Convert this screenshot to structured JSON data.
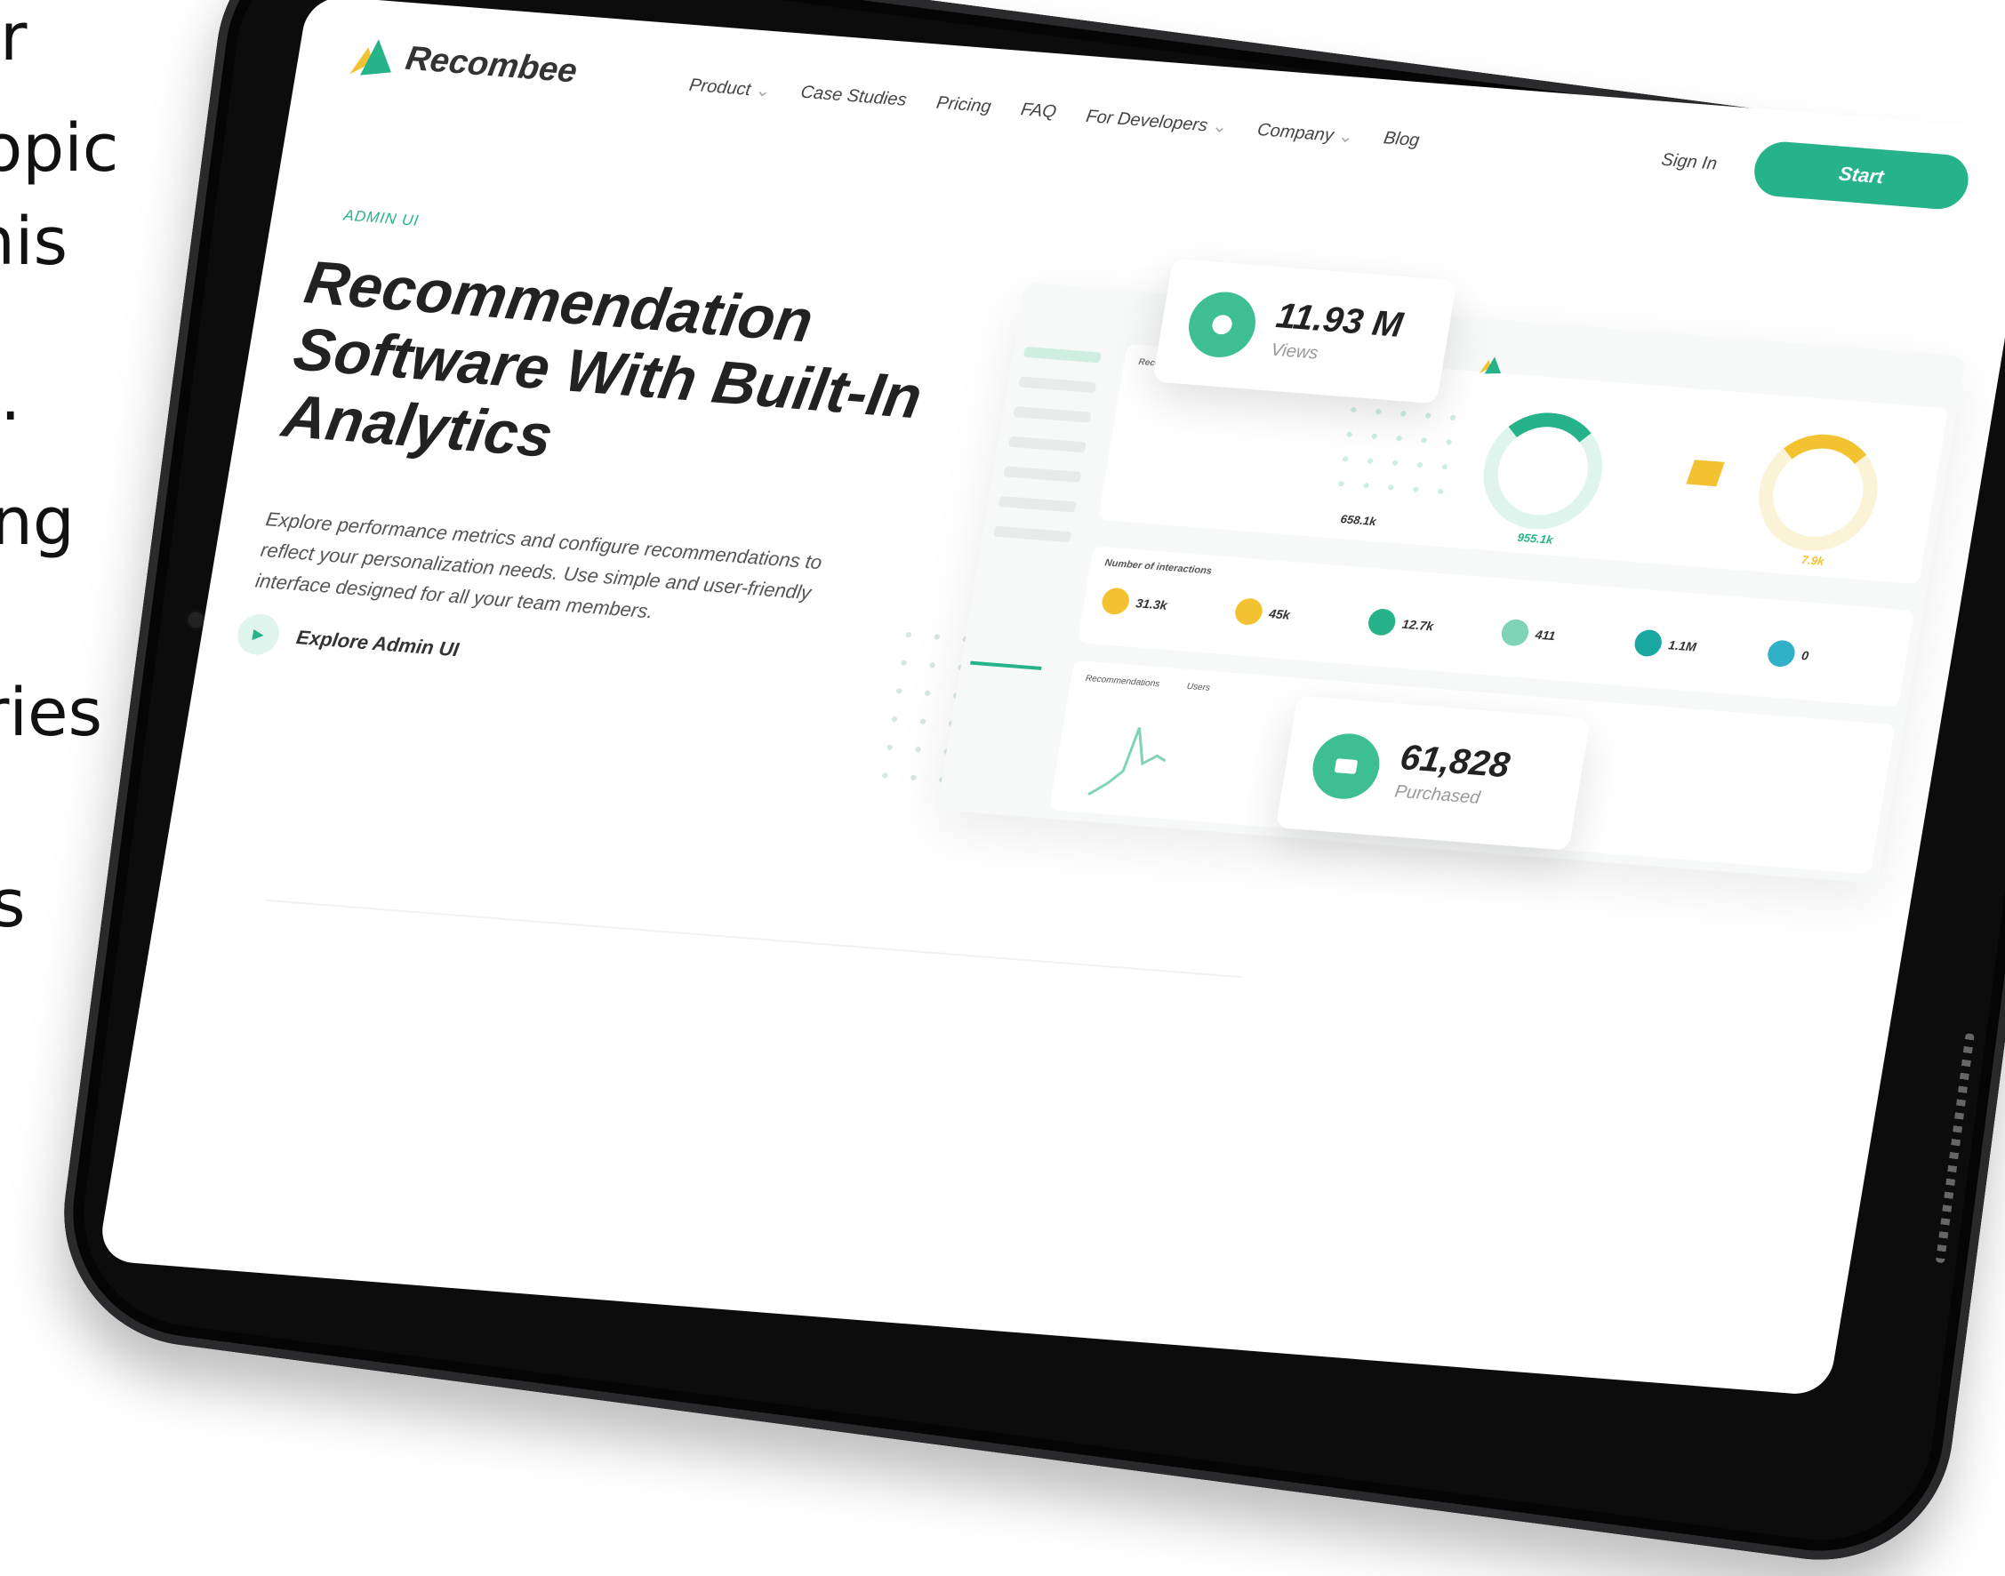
{
  "left_text": [
    "r",
    "opic",
    "his",
    ".",
    "ng",
    "ries",
    "s"
  ],
  "nav": {
    "brand": "Recombee",
    "links": [
      "Product",
      "Case Studies",
      "Pricing",
      "FAQ",
      "For Developers",
      "Company",
      "Blog"
    ],
    "sign_in": "Sign In",
    "start": "Start"
  },
  "hero": {
    "eyebrow": "ADMIN UI",
    "title_lines": [
      "Recommendation",
      "Software With Built-In",
      "Analytics"
    ],
    "description": "Explore performance metrics and configure recommendations to reflect your personalization needs. Use simple and user-friendly interface designed for all your team members.",
    "cta": "Explore Admin UI"
  },
  "cards": {
    "views": {
      "value": "11.93 M",
      "label": "Views"
    },
    "purchased": {
      "value": "61,828",
      "label": "Purchased"
    }
  },
  "dashboard": {
    "title": "Recommendation Score",
    "metric_left": "658.1k",
    "metric_mid": "955.1k",
    "metric_right": "7.9k",
    "strip_title": "Number of interactions",
    "chips": [
      {
        "value": "31.3k",
        "color": "#f2c230"
      },
      {
        "value": "45k",
        "color": "#f2c230"
      },
      {
        "value": "12.7k",
        "color": "#27b38a"
      },
      {
        "value": "411",
        "color": "#7fd3b6"
      },
      {
        "value": "1.1M",
        "color": "#1aa7a0"
      },
      {
        "value": "0",
        "color": "#2fb1c9"
      }
    ],
    "chart_filters": [
      "Recommendations",
      "Users"
    ]
  },
  "colors": {
    "accent": "#27b38a",
    "yellow": "#f2c230",
    "bezel": "#0c0c0d"
  }
}
